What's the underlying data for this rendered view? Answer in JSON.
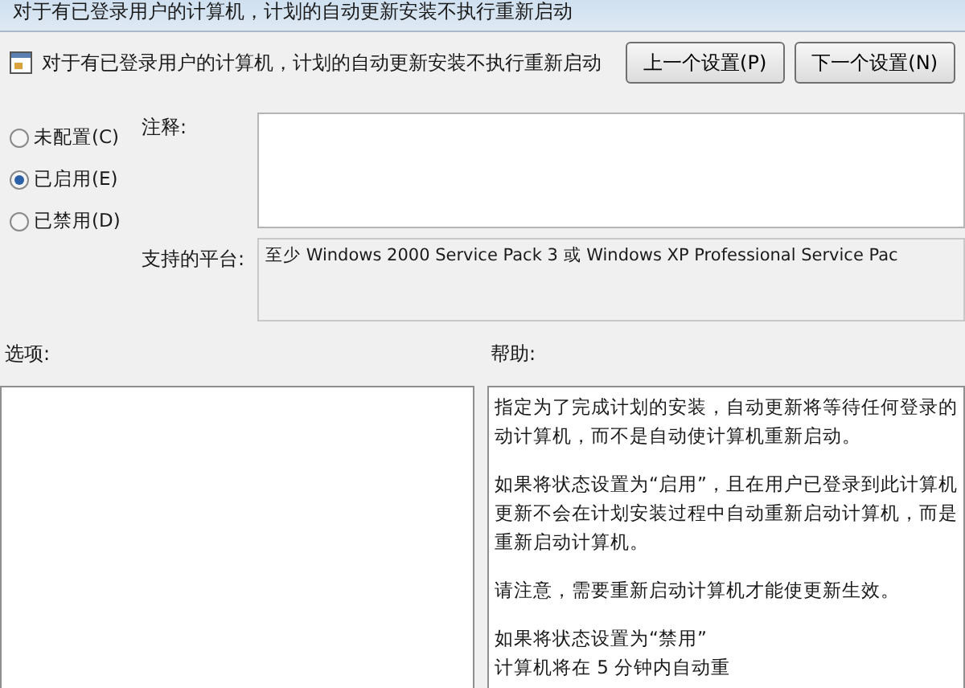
{
  "window": {
    "title": "对于有已登录用户的计算机，计划的自动更新安装不执行重新启动"
  },
  "header": {
    "title": "对于有已登录用户的计算机，计划的自动更新安装不执行重新启动",
    "buttons": [
      "上一个设置(P)",
      "下一个设置(N)"
    ]
  },
  "state_options": [
    {
      "label": "未配置(C)",
      "selected": false
    },
    {
      "label": "已启用(E)",
      "selected": true
    },
    {
      "label": "已禁用(D)",
      "selected": false
    }
  ],
  "comment": {
    "label": "注释:"
  },
  "platform": {
    "label": "支持的平台:",
    "value": "至少 Windows 2000 Service Pack 3 或 Windows XP Professional Service Pac"
  },
  "options": {
    "label": "选项:"
  },
  "help": {
    "label": "帮助:",
    "paragraphs": [
      [
        "指定为了完成计划的安装，自动更新将等待任何登录的",
        "动计算机，而不是自动使计算机重新启动。"
      ],
      [
        "如果将状态设置为“启用”，且在用户已登录到此计算机",
        "更新不会在计划安装过程中自动重新启动计算机，而是",
        "重新启动计算机。"
      ],
      [
        "请注意，需要重新启动计算机才能使更新生效。"
      ],
      [
        "如果将状态设置为“禁用”",
        "计算机将在 5 分钟内自动重"
      ]
    ]
  }
}
